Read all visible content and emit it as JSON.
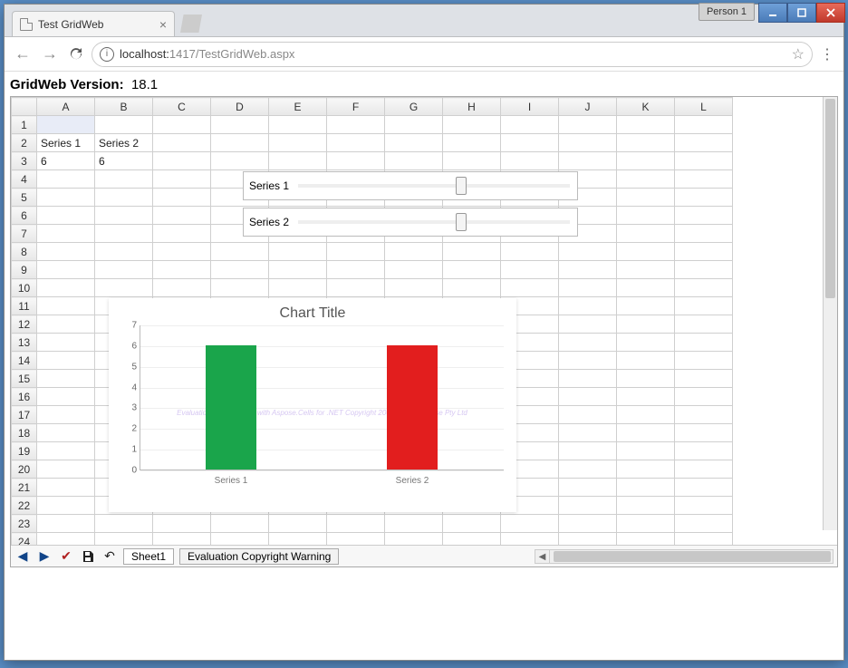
{
  "window": {
    "person_label": "Person 1"
  },
  "browser": {
    "tab_title": "Test GridWeb",
    "url_display": "localhost:1417/TestGridWeb.aspx",
    "url_host": "localhost:",
    "url_port_path": "1417/TestGridWeb.aspx"
  },
  "page": {
    "version_label": "GridWeb Version:",
    "version_value": "18.1"
  },
  "grid": {
    "columns": [
      "A",
      "B",
      "C",
      "D",
      "E",
      "F",
      "G",
      "H",
      "I",
      "J",
      "K",
      "L"
    ],
    "row_count": 24,
    "cells": {
      "A2": "Series 1",
      "B2": "Series 2",
      "A3": "6",
      "B3": "6"
    },
    "sliders": [
      {
        "label": "Series 1"
      },
      {
        "label": "Series 2"
      }
    ]
  },
  "chart_data": {
    "type": "bar",
    "title": "Chart Title",
    "categories": [
      "Series 1",
      "Series 2"
    ],
    "values": [
      6,
      6
    ],
    "colors": [
      "#1aa54b",
      "#e21e1e"
    ],
    "ylim": [
      0,
      7
    ],
    "yticks": [
      0,
      1,
      2,
      3,
      4,
      5,
      6,
      7
    ],
    "watermark": "Evaluation only. Created with Aspose.Cells for .NET Copyright 2003 - 2018 Aspose Pty Ltd",
    "xlabel": "",
    "ylabel": ""
  },
  "footer": {
    "sheet_tabs": [
      "Sheet1",
      "Evaluation Copyright Warning"
    ]
  }
}
